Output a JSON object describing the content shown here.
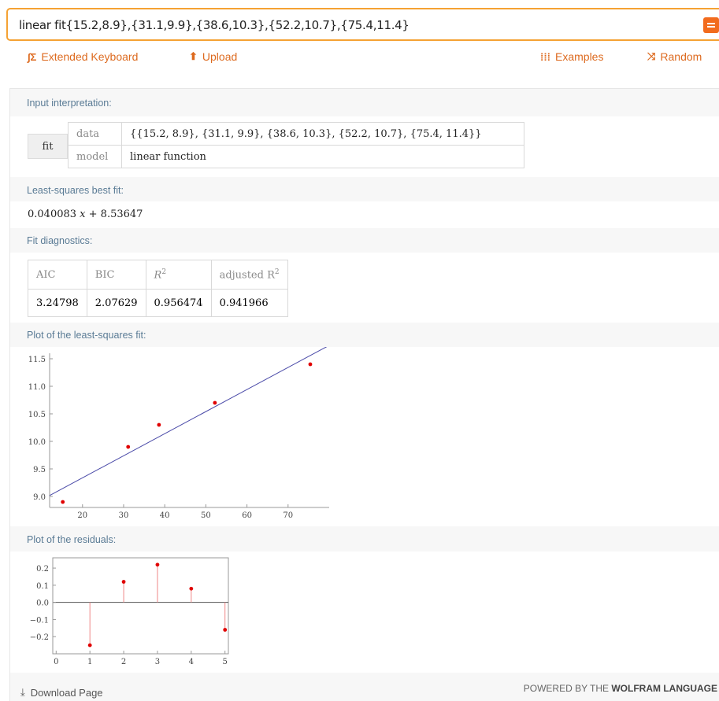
{
  "search": {
    "query": "linear fit{15.2,8.9},{31.1,9.9},{38.6,10.3},{52.2,10.7},{75.4,11.4}"
  },
  "toolbar": {
    "keyboard_label": "Extended Keyboard",
    "upload_label": "Upload",
    "examples_label": "Examples",
    "random_label": "Random"
  },
  "input_interpretation": {
    "title": "Input interpretation:",
    "fit_label": "fit",
    "rows": [
      {
        "key": "data",
        "value": "{{15.2, 8.9}, {31.1, 9.9}, {38.6, 10.3}, {52.2, 10.7}, {75.4, 11.4}}"
      },
      {
        "key": "model",
        "value": "linear function"
      }
    ]
  },
  "best_fit": {
    "title": "Least-squares best fit:",
    "coef": "0.040083",
    "var": "x",
    "rest": "+ 8.53647"
  },
  "diagnostics": {
    "title": "Fit diagnostics:",
    "headers": [
      "AIC",
      "BIC",
      "R",
      "adjusted R"
    ],
    "sup": "2",
    "values": [
      "3.24798",
      "2.07629",
      "0.956474",
      "0.941966"
    ]
  },
  "fit_plot_title": "Plot of the least-squares fit:",
  "residual_plot_title": "Plot of the residuals:",
  "chart_data": [
    {
      "type": "scatter",
      "title": "",
      "x": [
        15.2,
        31.1,
        38.6,
        52.2,
        75.4
      ],
      "y": [
        8.9,
        9.9,
        10.3,
        10.7,
        11.4
      ],
      "fit_line": {
        "slope": 0.040083,
        "intercept": 8.53647
      },
      "xlim": [
        12,
        80
      ],
      "ylim": [
        8.8,
        11.6
      ],
      "xticks": [
        "20",
        "30",
        "40",
        "50",
        "60",
        "70"
      ],
      "yticks": [
        "9.0",
        "9.5",
        "10.0",
        "10.5",
        "11.0",
        "11.5"
      ],
      "xlabel": "",
      "ylabel": ""
    },
    {
      "type": "scatter",
      "title": "",
      "x": [
        1,
        2,
        3,
        4,
        5
      ],
      "y": [
        -0.25,
        0.12,
        0.22,
        0.08,
        -0.16
      ],
      "xlim": [
        -0.1,
        5.1
      ],
      "ylim": [
        -0.3,
        0.26
      ],
      "xticks": [
        "0",
        "1",
        "2",
        "3",
        "4",
        "5"
      ],
      "yticks": [
        "0.2",
        "0.1",
        "0.0",
        "−0.1",
        "−0.2"
      ],
      "xlabel": "",
      "ylabel": ""
    }
  ],
  "footer": {
    "download_label": "Download Page",
    "powered_prefix": "POWERED BY THE",
    "powered_brand": "WOLFRAM LANGUAGE"
  }
}
